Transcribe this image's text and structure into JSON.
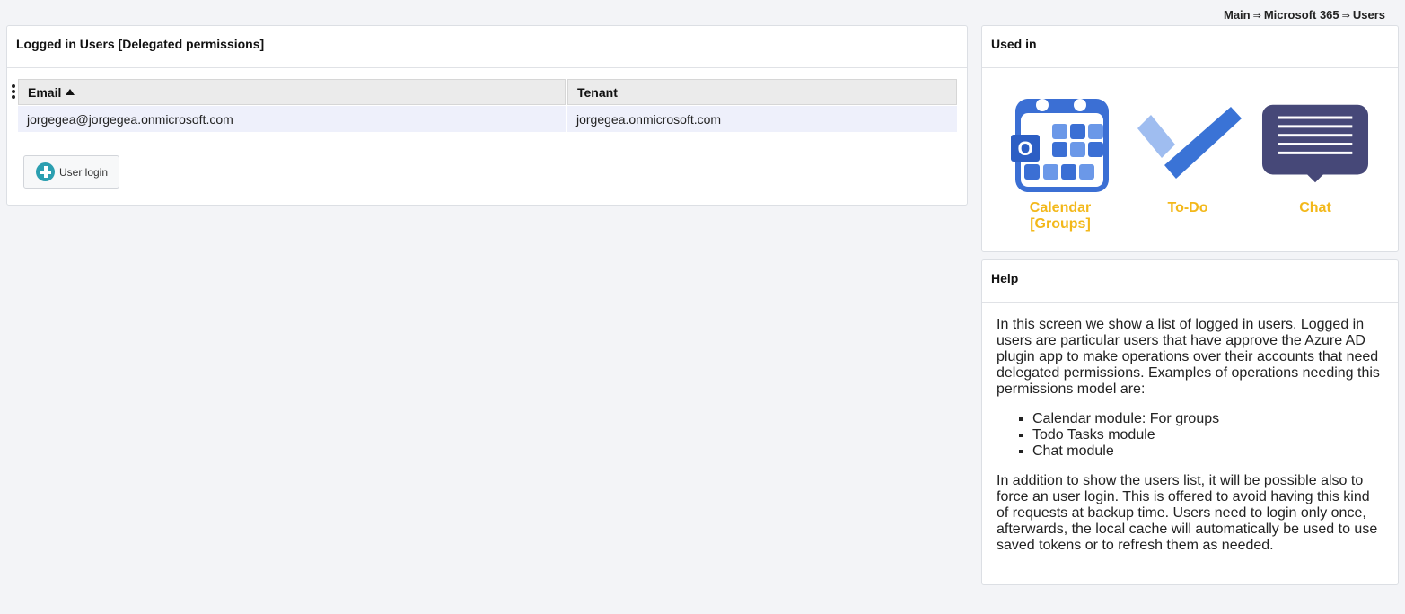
{
  "breadcrumb": {
    "items": [
      "Main",
      "Microsoft 365",
      "Users"
    ],
    "separator": "⇒"
  },
  "users_panel": {
    "title": "Logged in Users [Delegated permissions]",
    "columns": {
      "email": "Email",
      "tenant": "Tenant"
    },
    "sort": {
      "column": "email",
      "direction": "ascending"
    },
    "rows": [
      {
        "email": "jorgegea@jorgegea.onmicrosoft.com",
        "tenant": "jorgegea.onmicrosoft.com"
      }
    ],
    "login_button": "User login"
  },
  "used_in": {
    "title": "Used in",
    "modules": [
      {
        "label": "Calendar [Groups]",
        "icon": "outlook-calendar-icon"
      },
      {
        "label": "To-Do",
        "icon": "todo-check-icon"
      },
      {
        "label": "Chat",
        "icon": "chat-bubble-icon"
      }
    ]
  },
  "help": {
    "title": "Help",
    "intro": "In this screen we show a list of logged in users. Logged in users are particular users that have approve the Azure AD plugin app to make operations over their accounts that need delegated permissions. Examples of operations needing this permissions model are:",
    "items": [
      "Calendar module: For groups",
      "Todo Tasks module",
      "Chat module"
    ],
    "outro": "In addition to show the users list, it will be possible also to force an user login. This is offered to avoid having this kind of requests at backup time. Users need to login only once, afterwards, the local cache will automatically be used to use saved tokens or to refresh them as needed."
  },
  "colors": {
    "accent_label": "#f3b81a",
    "row_highlight": "#eef0fb",
    "calendar_blue": "#3b6fd4",
    "todo_blue": "#3a73d6",
    "chat_purple": "#464878",
    "add_button": "#2b9fb0"
  }
}
